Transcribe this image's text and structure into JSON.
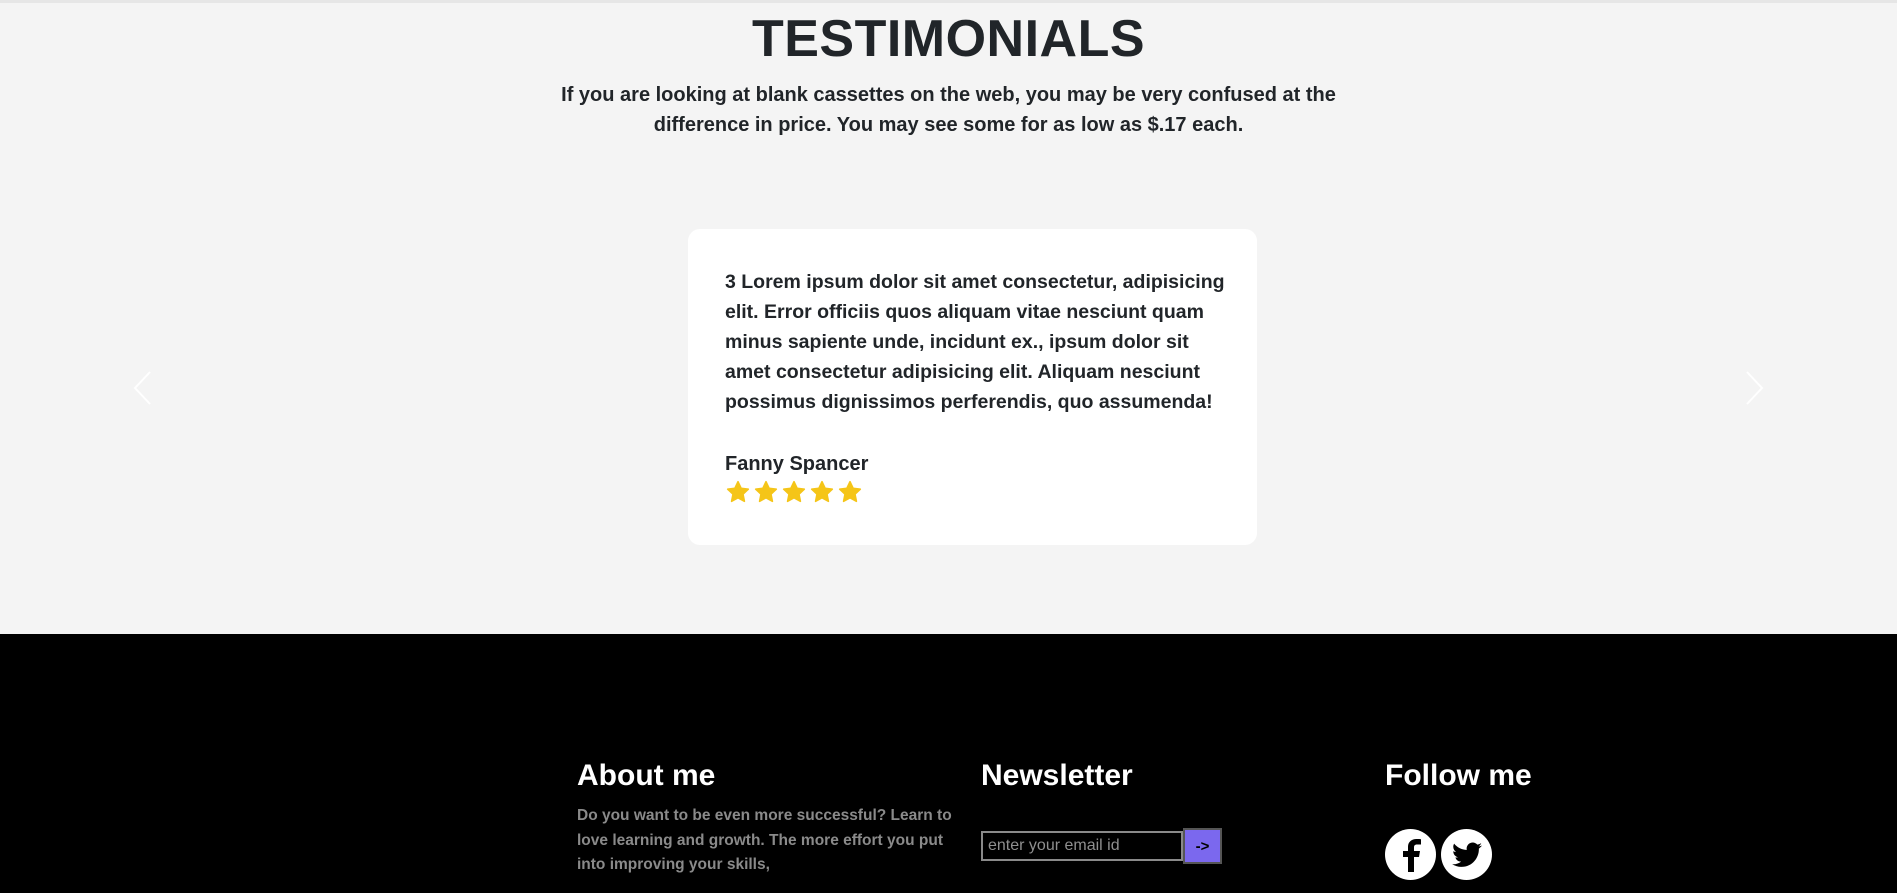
{
  "testimonials": {
    "title": "TESTIMONIALS",
    "subtitle": "If you are looking at blank cassettes on the web, you may be very confused at the difference in price. You may see some for as low as $.17 each.",
    "active_card": {
      "quote": "3 Lorem ipsum dolor sit amet consectetur, adipisicing elit. Error officiis quos aliquam vitae nesciunt quam minus sapiente unde, incidunt ex., ipsum dolor sit amet consectetur adipisicing elit. Aliquam nesciunt possimus dignissimos perferendis, quo assumenda!",
      "author": "Fanny Spancer",
      "rating": 5,
      "rating_max": 5
    },
    "icons": {
      "prev": "chevron-left-icon",
      "next": "chevron-right-icon",
      "star": "star-icon"
    },
    "colors": {
      "star": "#f5c518",
      "section_bg": "#f4f4f4",
      "card_bg": "#ffffff"
    }
  },
  "footer": {
    "about": {
      "heading": "About me",
      "text": "Do you want to be even more successful? Learn to love learning and growth. The more effort you put into improving your skills,"
    },
    "newsletter": {
      "heading": "Newsletter",
      "email_placeholder": "enter your email id",
      "email_value": "",
      "submit_label": "->"
    },
    "follow": {
      "heading": "Follow me",
      "icons": [
        "facebook-icon",
        "twitter-icon"
      ]
    },
    "colors": {
      "bg": "#000000",
      "submit_bg": "#7b68ee"
    }
  }
}
